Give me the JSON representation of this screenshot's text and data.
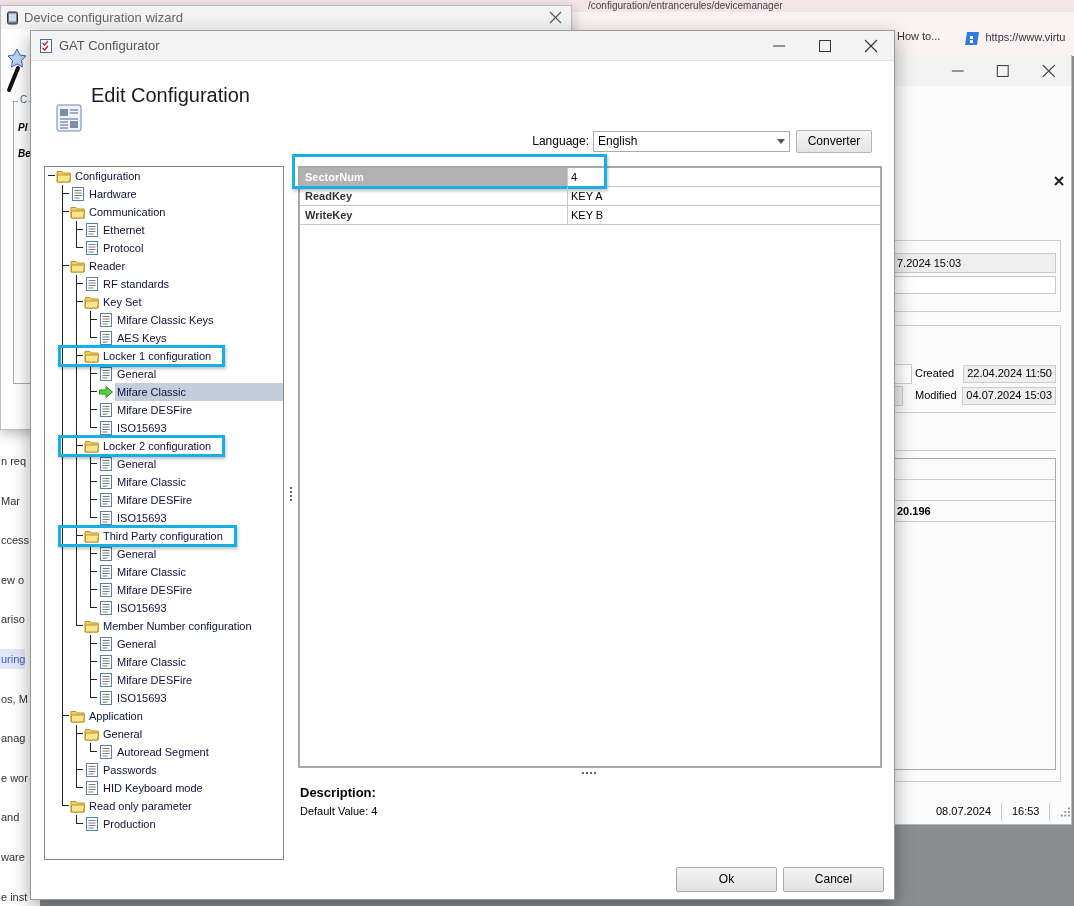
{
  "browser": {
    "address_text": "/configuration/entrancerules/devicemanager",
    "bookmarks": [
      {
        "label": "How to...",
        "kind": "plain"
      },
      {
        "label": "https://www.virtu",
        "kind": "site"
      }
    ]
  },
  "page_fragments": [
    {
      "text": "n req",
      "selected": false
    },
    {
      "text": "Mar",
      "selected": false
    },
    {
      "text": "ccess",
      "selected": false
    },
    {
      "text": "ew o",
      "selected": false
    },
    {
      "text": "ariso",
      "selected": false
    },
    {
      "text": "uring",
      "selected": true
    },
    {
      "text": "os, M",
      "selected": false
    },
    {
      "text": "anag",
      "selected": false
    },
    {
      "text": "e wor",
      "selected": false
    },
    {
      "text": "and",
      "selected": false
    },
    {
      "text": "ware",
      "selected": false
    },
    {
      "text": "e inst",
      "selected": false
    }
  ],
  "wizard_window": {
    "title": "Device configuration wizard",
    "group_title": "C",
    "labels": [
      "Pl",
      "Be"
    ]
  },
  "back_window": {
    "field_1": "7.2024 15:03",
    "created_label": "Created",
    "created": "22.04.2024 11:50",
    "modified_label": "Modified",
    "modified": "04.07.2024 15:03",
    "table_value": "20.196",
    "status_date": "08.07.2024",
    "status_time": "16:53"
  },
  "window": {
    "title": "GAT Configurator"
  },
  "header": {
    "title": "Edit Configuration"
  },
  "language": {
    "label": "Language:",
    "value": "English"
  },
  "converter_button": "Converter",
  "tree": [
    {
      "label": "Configuration",
      "kind": "folder",
      "selected": false,
      "highlighted": false,
      "children": [
        {
          "label": "Hardware",
          "kind": "page",
          "selected": false,
          "highlighted": false
        },
        {
          "label": "Communication",
          "kind": "folder",
          "selected": false,
          "highlighted": false,
          "children": [
            {
              "label": "Ethernet",
              "kind": "page",
              "selected": false,
              "highlighted": false
            },
            {
              "label": "Protocol",
              "kind": "page",
              "selected": false,
              "highlighted": false
            }
          ]
        },
        {
          "label": "Reader",
          "kind": "folder",
          "selected": false,
          "highlighted": false,
          "children": [
            {
              "label": "RF standards",
              "kind": "page",
              "selected": false,
              "highlighted": false
            },
            {
              "label": "Key Set",
              "kind": "folder",
              "selected": false,
              "highlighted": false,
              "children": [
                {
                  "label": "Mifare Classic Keys",
                  "kind": "page",
                  "selected": false,
                  "highlighted": false
                },
                {
                  "label": "AES Keys",
                  "kind": "page",
                  "selected": false,
                  "highlighted": false
                }
              ]
            },
            {
              "label": "Locker 1 configuration",
              "kind": "folder",
              "selected": false,
              "highlighted": true,
              "children": [
                {
                  "label": "General",
                  "kind": "page",
                  "selected": false,
                  "highlighted": false
                },
                {
                  "label": "Mifare Classic",
                  "kind": "page",
                  "selected": true,
                  "highlighted": false
                },
                {
                  "label": "Mifare DESFire",
                  "kind": "page",
                  "selected": false,
                  "highlighted": false
                },
                {
                  "label": "ISO15693",
                  "kind": "page",
                  "selected": false,
                  "highlighted": false
                }
              ]
            },
            {
              "label": "Locker 2 configuration",
              "kind": "folder",
              "selected": false,
              "highlighted": true,
              "children": [
                {
                  "label": "General",
                  "kind": "page",
                  "selected": false,
                  "highlighted": false
                },
                {
                  "label": "Mifare Classic",
                  "kind": "page",
                  "selected": false,
                  "highlighted": false
                },
                {
                  "label": "Mifare DESFire",
                  "kind": "page",
                  "selected": false,
                  "highlighted": false
                },
                {
                  "label": "ISO15693",
                  "kind": "page",
                  "selected": false,
                  "highlighted": false
                }
              ]
            },
            {
              "label": "Third Party configuration",
              "kind": "folder",
              "selected": false,
              "highlighted": true,
              "children": [
                {
                  "label": "General",
                  "kind": "page",
                  "selected": false,
                  "highlighted": false
                },
                {
                  "label": "Mifare Classic",
                  "kind": "page",
                  "selected": false,
                  "highlighted": false
                },
                {
                  "label": "Mifare DESFire",
                  "kind": "page",
                  "selected": false,
                  "highlighted": false
                },
                {
                  "label": "ISO15693",
                  "kind": "page",
                  "selected": false,
                  "highlighted": false
                }
              ]
            },
            {
              "label": "Member Number configuration",
              "kind": "folder",
              "selected": false,
              "highlighted": false,
              "children": [
                {
                  "label": "General",
                  "kind": "page",
                  "selected": false,
                  "highlighted": false
                },
                {
                  "label": "Mifare Classic",
                  "kind": "page",
                  "selected": false,
                  "highlighted": false
                },
                {
                  "label": "Mifare DESFire",
                  "kind": "page",
                  "selected": false,
                  "highlighted": false
                },
                {
                  "label": "ISO15693",
                  "kind": "page",
                  "selected": false,
                  "highlighted": false
                }
              ]
            }
          ]
        },
        {
          "label": "Application",
          "kind": "folder",
          "selected": false,
          "highlighted": false,
          "children": [
            {
              "label": "General",
              "kind": "folder",
              "selected": false,
              "highlighted": false,
              "children": [
                {
                  "label": "Autoread Segment",
                  "kind": "page",
                  "selected": false,
                  "highlighted": false
                }
              ]
            },
            {
              "label": "Passwords",
              "kind": "page",
              "selected": false,
              "highlighted": false
            },
            {
              "label": "HID Keyboard mode",
              "kind": "page",
              "selected": false,
              "highlighted": false
            }
          ]
        },
        {
          "label": "Read only parameter",
          "kind": "folder",
          "selected": false,
          "highlighted": false,
          "children": [
            {
              "label": "Production",
              "kind": "page",
              "selected": false,
              "highlighted": false
            }
          ]
        }
      ]
    }
  ],
  "properties": {
    "rows": [
      {
        "name": "SectorNum",
        "value": "4",
        "selected": true,
        "highlighted": true
      },
      {
        "name": "ReadKey",
        "value": "KEY A",
        "selected": false,
        "highlighted": false
      },
      {
        "name": "WriteKey",
        "value": "KEY B",
        "selected": false,
        "highlighted": false
      }
    ]
  },
  "description": {
    "title": "Description:",
    "text": "Default Value: 4"
  },
  "buttons": [
    "Ok",
    "Cancel"
  ]
}
